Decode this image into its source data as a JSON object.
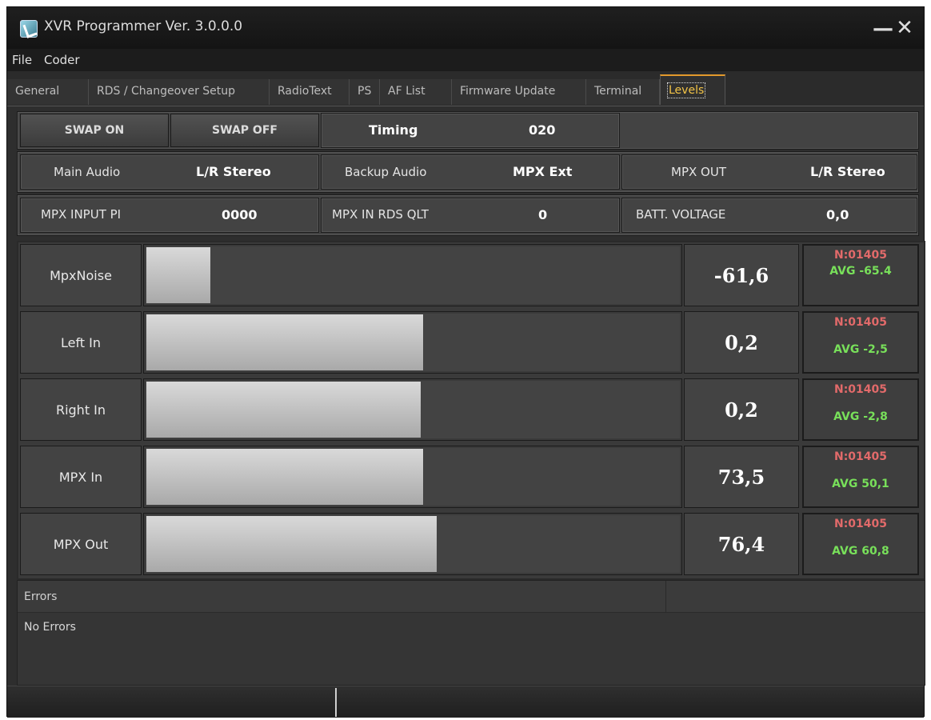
{
  "window": {
    "title": "XVR Programmer  Ver. 3.0.0.0",
    "minimize_glyph": "—",
    "close_glyph": "✕"
  },
  "menu": [
    "File",
    "Coder"
  ],
  "tabs": [
    {
      "label": "General"
    },
    {
      "label": "RDS / Changeover Setup"
    },
    {
      "label": "RadioText"
    },
    {
      "label": "PS"
    },
    {
      "label": "AF List"
    },
    {
      "label": "Firmware Update"
    },
    {
      "label": "Terminal"
    },
    {
      "label": "Levels",
      "active": true
    }
  ],
  "controls": {
    "swap_on": "SWAP ON",
    "swap_off": "SWAP OFF",
    "timing_label": "Timing",
    "timing_value": "020"
  },
  "audio": {
    "main_label": "Main Audio",
    "main_value": "L/R Stereo",
    "backup_label": "Backup Audio",
    "backup_value": "MPX Ext",
    "mpxout_label": "MPX OUT",
    "mpxout_value": "L/R Stereo"
  },
  "info": {
    "pi_label": "MPX INPUT PI",
    "pi_value": "0000",
    "qlt_label": "MPX IN RDS QLT",
    "qlt_value": "0",
    "batt_label": "BATT. VOLTAGE",
    "batt_value": "0,0"
  },
  "meters": [
    {
      "label": "MpxNoise",
      "value": "-61,6",
      "n": "N:01405",
      "avg": "AVG -65.4",
      "level": 0.12
    },
    {
      "label": "Left In",
      "value": "0,2",
      "n": "N:01405",
      "avg": "AVG -2,5",
      "level": 0.52
    },
    {
      "label": "Right In",
      "value": "0,2",
      "n": "N:01405",
      "avg": "AVG -2,8",
      "level": 0.515
    },
    {
      "label": "MPX In",
      "value": "73,5",
      "n": "N:01405",
      "avg": "AVG 50,1",
      "level": 0.52
    },
    {
      "label": "MPX Out",
      "value": "76,4",
      "n": "N:01405",
      "avg": "AVG 60,8",
      "level": 0.545
    }
  ],
  "errors": {
    "title": "Errors",
    "message": "No Errors"
  },
  "colors": {
    "background": "#2e2e2e",
    "active_tab": "#e39a2c",
    "stat_n": "#e26a6a",
    "stat_avg": "#78e05a"
  }
}
